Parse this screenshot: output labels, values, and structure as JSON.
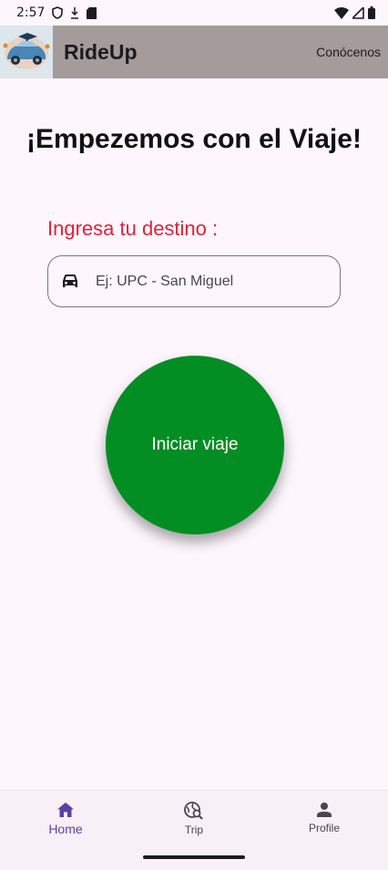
{
  "status_bar": {
    "time": "2:57"
  },
  "app_bar": {
    "title": "RideUp",
    "about_link": "Conócenos"
  },
  "main": {
    "headline": "¡Empezemos con el Viaje!",
    "destination_label": "Ingresa tu destino :",
    "destination_placeholder": "Ej: UPC - San Miguel",
    "destination_value": "",
    "start_button": "Iniciar viaje"
  },
  "bottom_nav": {
    "items": [
      {
        "label": "Home",
        "icon": "home-icon",
        "active": true
      },
      {
        "label": "Trip",
        "icon": "trip-search-icon",
        "active": false
      },
      {
        "label": "Profile",
        "icon": "person-icon",
        "active": false
      }
    ]
  },
  "colors": {
    "app_bar": "#a39c9b",
    "label_red": "#e0203a",
    "button_green": "#038e24",
    "nav_active": "#5a3fa6"
  }
}
